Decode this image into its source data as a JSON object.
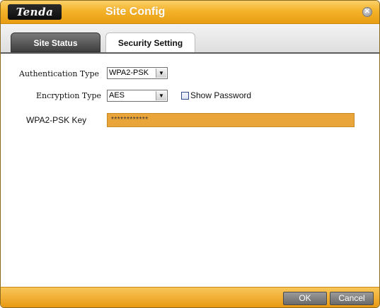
{
  "window": {
    "logo": "Tenda",
    "title": "Site Config"
  },
  "tabs": [
    {
      "label": "Site Status",
      "active": false
    },
    {
      "label": "Security Setting",
      "active": true
    }
  ],
  "form": {
    "auth_type_label": "Authentication Type",
    "auth_type_value": "WPA2-PSK",
    "encryption_type_label": "Encryption Type",
    "encryption_type_value": "AES",
    "show_password_label": "Show Password",
    "show_password_checked": false,
    "key_label": "WPA2-PSK Key",
    "key_value": "************"
  },
  "buttons": {
    "ok": "OK",
    "cancel": "Cancel"
  },
  "colors": {
    "accent_orange": "#f4b32a",
    "key_field": "#e9a43a",
    "active_tab_dark": "#3e3e3e"
  }
}
